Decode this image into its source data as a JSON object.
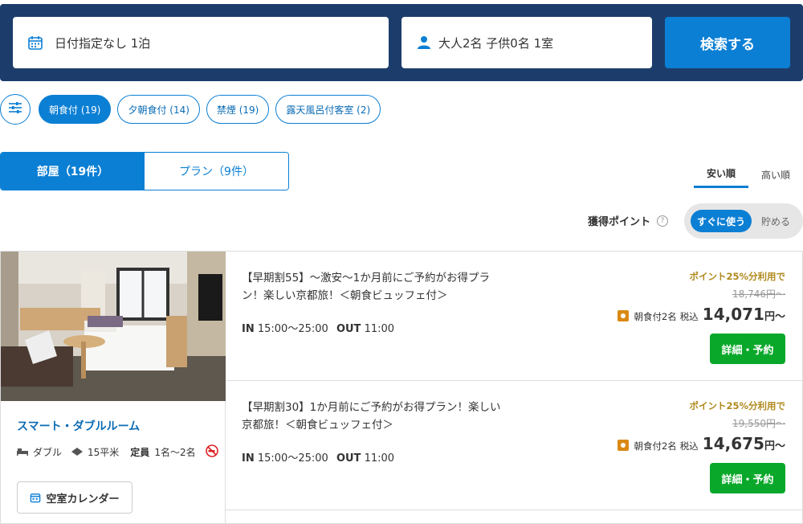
{
  "search": {
    "date_label": "日付指定なし 1泊",
    "guest_label": "大人2名  子供0名  1室",
    "search_button": "検索する",
    "calendar_icon": "calendar-icon",
    "person_icon": "person-icon"
  },
  "filters": {
    "toggle_icon": "sliders-icon",
    "chips": [
      {
        "label": "朝食付 (19)",
        "active": true
      },
      {
        "label": "夕朝食付 (14)",
        "active": false
      },
      {
        "label": "禁煙 (19)",
        "active": false
      },
      {
        "label": "露天風呂付客室 (2)",
        "active": false
      }
    ]
  },
  "tabs": {
    "rooms": "部屋（19件）",
    "plans": "プラン（9件）"
  },
  "sort": {
    "cheap": "安い順",
    "expensive": "高い順"
  },
  "points": {
    "label": "獲得ポイント",
    "help": "?",
    "use_now": "すぐに使う",
    "save": "貯める"
  },
  "room": {
    "name": "スマート・ダブルルーム",
    "bed": "ダブル",
    "size": "15平米",
    "capacity_label": "定員",
    "capacity": "1名〜2名",
    "calendar_button": "空室カレンダー"
  },
  "plans": [
    {
      "title": "【早期割55】〜激安〜1か月前にご予約がお得プラン！楽しい京都旅！＜朝食ビュッフェ付＞",
      "in_label": "IN",
      "in_time": "15:00〜25:00",
      "out_label": "OUT",
      "out_time": "11:00",
      "promo": "ポイント25%分利用で",
      "original_price": "18,746円〜",
      "meal": "朝食付2名",
      "tax": "税込",
      "price": "14,071",
      "yen": "円〜",
      "book": "詳細・予約"
    },
    {
      "title": "【早期割30】1か月前にご予約がお得プラン！楽しい京都旅！＜朝食ビュッフェ付＞",
      "in_label": "IN",
      "in_time": "15:00〜25:00",
      "out_label": "OUT",
      "out_time": "11:00",
      "promo": "ポイント25%分利用で",
      "original_price": "19,550円〜",
      "meal": "朝食付2名",
      "tax": "税込",
      "price": "14,675",
      "yen": "円〜",
      "book": "詳細・予約"
    }
  ],
  "colors": {
    "header_bg": "#1c3d6b",
    "accent": "#0b7fd4",
    "book_green": "#09a82a",
    "promo_gold": "#b08a1e"
  }
}
